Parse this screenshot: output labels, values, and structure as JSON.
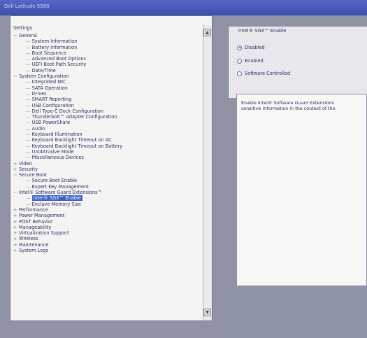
{
  "window": {
    "title": "Dell Latitude 5580"
  },
  "tree": {
    "root_label": "Settings",
    "items": [
      {
        "label": "General",
        "level": 0,
        "expander": "−"
      },
      {
        "label": "System Information",
        "level": 1
      },
      {
        "label": "Battery Information",
        "level": 1
      },
      {
        "label": "Boot Sequence",
        "level": 1
      },
      {
        "label": "Advanced Boot Options",
        "level": 1
      },
      {
        "label": "UEFI Boot Path Security",
        "level": 1
      },
      {
        "label": "Date/Time",
        "level": 1
      },
      {
        "label": "System Configuration",
        "level": 0,
        "expander": "−"
      },
      {
        "label": "Integrated NIC",
        "level": 1
      },
      {
        "label": "SATA Operation",
        "level": 1
      },
      {
        "label": "Drives",
        "level": 1
      },
      {
        "label": "SMART Reporting",
        "level": 1
      },
      {
        "label": "USB Configuration",
        "level": 1
      },
      {
        "label": "Dell Type-C Dock Configuration",
        "level": 1
      },
      {
        "label": "Thunderbolt™ Adapter Configuration",
        "level": 1
      },
      {
        "label": "USB PowerShare",
        "level": 1
      },
      {
        "label": "Audio",
        "level": 1
      },
      {
        "label": "Keyboard Illumination",
        "level": 1
      },
      {
        "label": "Keyboard Backlight Timeout on AC",
        "level": 1
      },
      {
        "label": "Keyboard Backlight Timeout on Battery",
        "level": 1
      },
      {
        "label": "Unobtrusive Mode",
        "level": 1
      },
      {
        "label": "Miscellaneous Devices",
        "level": 1
      },
      {
        "label": "Video",
        "level": 0,
        "expander": "+"
      },
      {
        "label": "Security",
        "level": 0,
        "expander": "+"
      },
      {
        "label": "Secure Boot",
        "level": 0,
        "expander": "−"
      },
      {
        "label": "Secure Boot Enable",
        "level": 1
      },
      {
        "label": "Expert Key Management",
        "level": 1
      },
      {
        "label": "Intel® Software Guard Extensions™",
        "level": 0,
        "expander": "−"
      },
      {
        "label": "Intel® SGX™ Enable",
        "level": 1,
        "selected": true
      },
      {
        "label": "Enclave Memory Size",
        "level": 1
      },
      {
        "label": "Performance",
        "level": 0,
        "expander": "+"
      },
      {
        "label": "Power Management",
        "level": 0,
        "expander": "+"
      },
      {
        "label": "POST Behavior",
        "level": 0,
        "expander": "+"
      },
      {
        "label": "Manageability",
        "level": 0,
        "expander": "+"
      },
      {
        "label": "Virtualization Support",
        "level": 0,
        "expander": "+"
      },
      {
        "label": "Wireless",
        "level": 0,
        "expander": "+"
      },
      {
        "label": "Maintenance",
        "level": 0,
        "expander": "+"
      },
      {
        "label": "System Logs",
        "level": 0,
        "expander": "+"
      }
    ]
  },
  "setting": {
    "title": "Intel® SGX™ Enable",
    "options": [
      {
        "label": "Disabled",
        "selected": true
      },
      {
        "label": "Enabled",
        "selected": false
      },
      {
        "label": "Software Controlled",
        "selected": false
      }
    ],
    "description_line1": "Enable Intel® Software Guard Extensions",
    "description_line2": "sensitive information in the context of the"
  },
  "colors": {
    "accent": "#3c62c9",
    "titlebar": "#4653b8",
    "background": "#8f93a5"
  },
  "icons": {
    "scroll_up": "▲",
    "scroll_down": "▼"
  }
}
